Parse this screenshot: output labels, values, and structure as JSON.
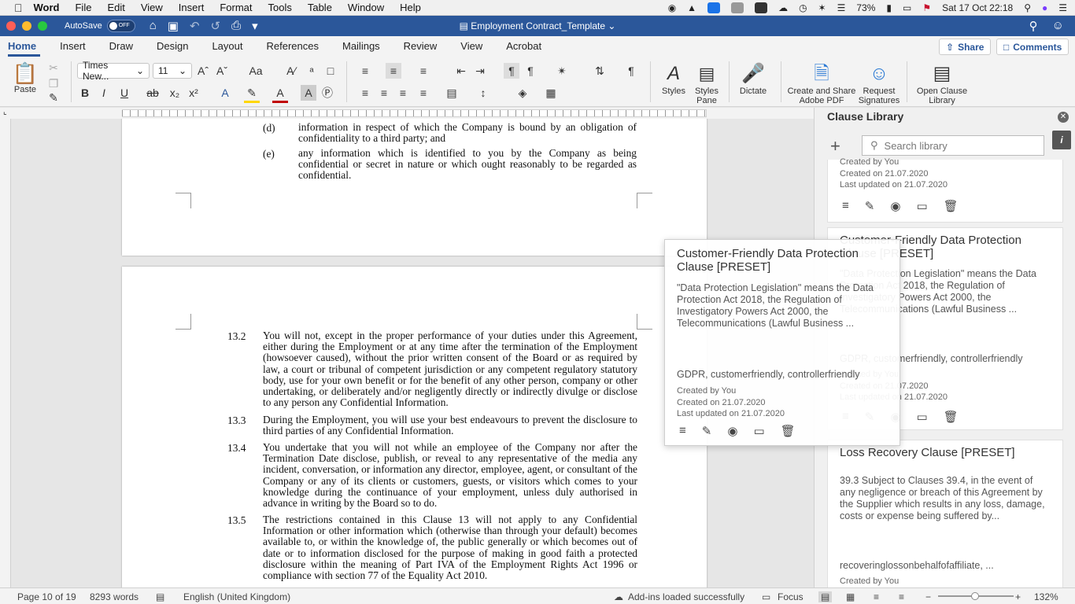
{
  "menubar": {
    "app": "Word",
    "items": [
      "File",
      "Edit",
      "View",
      "Insert",
      "Format",
      "Tools",
      "Table",
      "Window",
      "Help"
    ],
    "battery": "73%",
    "datetime": "Sat 17 Oct  22:18"
  },
  "titlebar": {
    "autosave_label": "AutoSave",
    "autosave_state": "OFF",
    "document_title": "Employment Contract_Template"
  },
  "tabs": [
    "Home",
    "Insert",
    "Draw",
    "Design",
    "Layout",
    "References",
    "Mailings",
    "Review",
    "View",
    "Acrobat"
  ],
  "share_label": "Share",
  "comments_label": "Comments",
  "ribbon": {
    "paste_label": "Paste",
    "font_name": "Times New...",
    "font_size": "11",
    "styles_label": "Styles",
    "styles_pane_label1": "Styles",
    "styles_pane_label2": "Pane",
    "dictate_label": "Dictate",
    "create_pdf_label1": "Create and Share",
    "create_pdf_label2": "Adobe PDF",
    "request_sig_label1": "Request",
    "request_sig_label2": "Signatures",
    "open_clause_label1": "Open Clause",
    "open_clause_label2": "Library"
  },
  "document": {
    "top_fragment_num": "(d)",
    "top_fragment": "information in respect of which the Company is bound by an obligation of confidentiality to a third party; and",
    "item_e_num": "(e)",
    "item_e": "any information which is identified to you by the Company as being confidential or secret in nature or which ought reasonably to be regarded as confidential.",
    "clauses": [
      {
        "num": "13.2",
        "text": "You will not, except in the proper performance of your duties under this Agreement, either during the Employment or at any time after the termination of the Employment (howsoever caused), without the prior written consent of the Board or as required by law, a court or tribunal of competent jurisdiction or any competent regulatory statutory body, use for your own benefit or for the benefit of any other person, company or other undertaking, or deliberately and/or negligently directly or indirectly divulge or disclose to any person any Confidential Information."
      },
      {
        "num": "13.3",
        "text": "During the Employment, you will use your best endeavours to prevent the disclosure to third parties of any Confidential Information."
      },
      {
        "num": "13.4",
        "text": "You undertake that you will not while an employee of the Company nor after the Termination Date disclose, publish, or reveal to any representative of the media any incident, conversation, or information any director, employee, agent, or consultant of the Company or any of its clients or customers, guests, or visitors which comes to your knowledge during the continuance of your employment, unless duly authorised in advance in writing by the Board so to do."
      },
      {
        "num": "13.5",
        "text": "The restrictions contained in this Clause 13 will not apply to any Confidential Information or other information which (otherwise than through your default) becomes available to, or within the knowledge of, the public generally or which becomes out of date or to information disclosed for the purpose of making in good faith a protected disclosure within the meaning of Part IVA of the Employment Rights Act 1996 or compliance with section 77 of the Equality Act 2010."
      }
    ]
  },
  "clause_library": {
    "title": "Clause Library",
    "search_placeholder": "Search library",
    "card0": {
      "created_by": "Created by You",
      "created_on": "Created on 21.07.2020",
      "updated_on": "Last updated on 21.07.2020"
    },
    "card1": {
      "title": "Customer-Friendly Data Protection Clause [PRESET]",
      "body": "\"Data Protection Legislation\" means the Data Protection Act 2018, the Regulation of Investigatory Powers Act 2000, the Telecommunications (Lawful Business ...",
      "tags": "GDPR, customerfriendly, controllerfriendly",
      "created_by": "Created by You",
      "created_on": "Created on 21.07.2020",
      "updated_on": "Last updated on 21.07.2020"
    },
    "card2": {
      "title": "Loss Recovery Clause [PRESET]",
      "body": "39.3 Subject to Clauses 39.4, in the event of any negligence or breach of this Agreement by the Supplier which results in any loss, damage, costs or expense being suffered by...",
      "tags": "recoveringlossonbehalfofaffiliate, ...",
      "created_by": "Created by You"
    }
  },
  "popup": {
    "title": "Customer-Friendly Data Protection Clause [PRESET]",
    "body": "\"Data Protection Legislation\" means the Data Protection Act 2018, the Regulation of Investigatory Powers Act 2000, the Telecommunications (Lawful Business ...",
    "tags": "GDPR, customerfriendly, controllerfriendly",
    "created_by": "Created by You",
    "created_on": "Created on 21.07.2020",
    "updated_on": "Last updated on 21.07.2020"
  },
  "status": {
    "page": "Page 10 of 19",
    "words": "8293 words",
    "language": "English (United Kingdom)",
    "addins": "Add-ins loaded successfully",
    "focus": "Focus",
    "zoom": "132%"
  },
  "colors": {
    "accent": "#2b579a",
    "font_color_red": "#c00000",
    "highlight_yellow": "#ffd700"
  }
}
